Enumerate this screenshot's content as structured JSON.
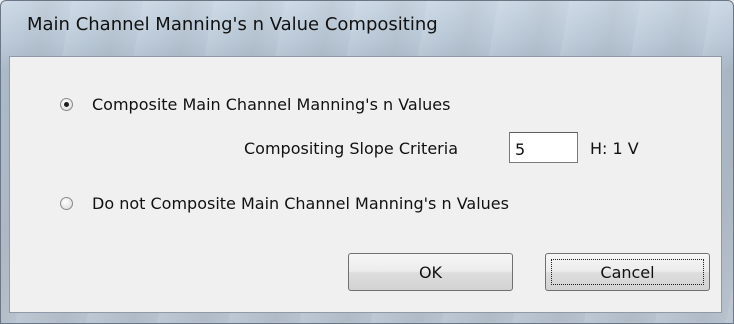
{
  "window": {
    "title": "Main Channel Manning's n Value Compositing"
  },
  "options": {
    "composite_label": "Composite Main Channel Manning's n Values",
    "composite_selected": true,
    "no_composite_label": "Do not Composite Main Channel Manning's n Values",
    "no_composite_selected": false
  },
  "slope": {
    "label": "Compositing Slope Criteria",
    "value": "5",
    "unit": "H: 1 V"
  },
  "buttons": {
    "ok_label": "OK",
    "cancel_label": "Cancel"
  }
}
